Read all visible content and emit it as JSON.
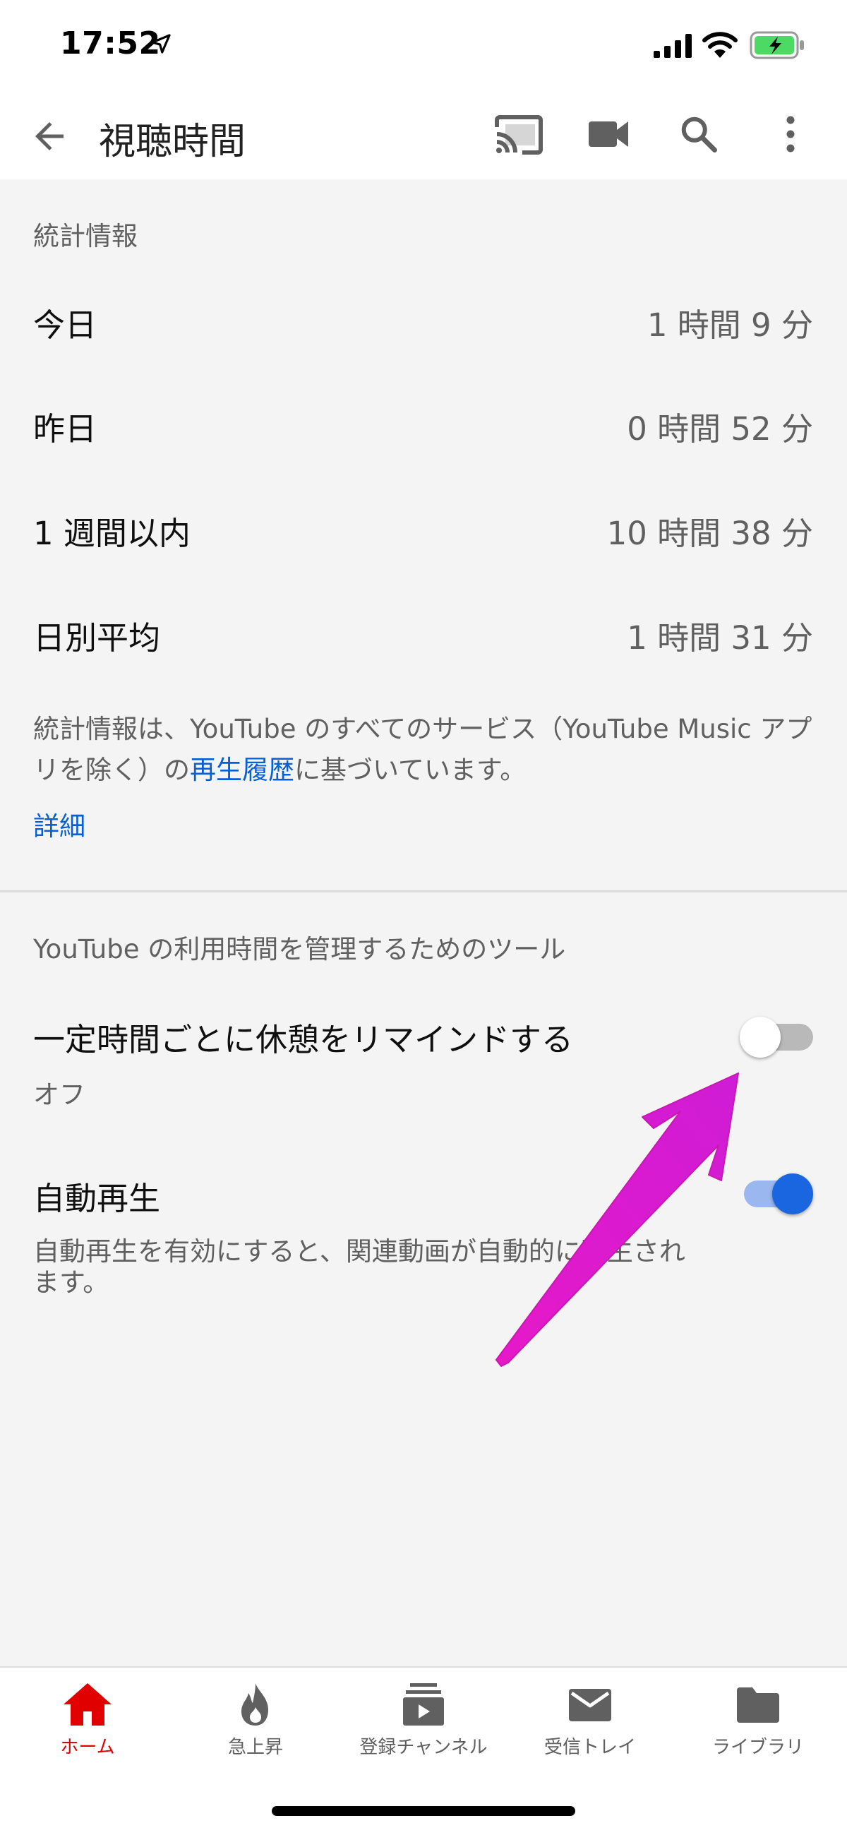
{
  "status_bar": {
    "time": "17:52"
  },
  "app_bar": {
    "title": "視聴時間"
  },
  "stats": {
    "header": "統計情報",
    "rows": [
      {
        "label": "今日",
        "value": "1 時間 9 分"
      },
      {
        "label": "昨日",
        "value": "0 時間 52 分"
      },
      {
        "label": "1 週間以内",
        "value": "10 時間 38 分"
      },
      {
        "label": "日別平均",
        "value": "1 時間 31 分"
      }
    ],
    "info_prefix": "統計情報は、YouTube のすべてのサービス（YouTube Music アプリを除く）の",
    "info_link": "再生履歴",
    "info_suffix": "に基づいています。",
    "detail_link": "詳細"
  },
  "tools": {
    "header": "YouTube の利用時間を管理するためのツール",
    "break_reminder": {
      "title": "一定時間ごとに休憩をリマインドする",
      "subtitle": "オフ",
      "enabled": false
    },
    "autoplay": {
      "title": "自動再生",
      "subtitle": "自動再生を有効にすると、関連動画が自動的に再生されます。",
      "enabled": true
    }
  },
  "bottom_nav": {
    "items": [
      {
        "label": "ホーム",
        "icon": "home-icon",
        "active": true
      },
      {
        "label": "急上昇",
        "icon": "fire-icon",
        "active": false
      },
      {
        "label": "登録チャンネル",
        "icon": "subscriptions-icon",
        "active": false
      },
      {
        "label": "受信トレイ",
        "icon": "mail-icon",
        "active": false
      },
      {
        "label": "ライブラリ",
        "icon": "folder-icon",
        "active": false
      }
    ]
  },
  "colors": {
    "accent_red": "#e00000",
    "link_blue": "#065fd4",
    "toggle_on": "#1a66e0",
    "annotation_magenta": "#e61ec8"
  }
}
